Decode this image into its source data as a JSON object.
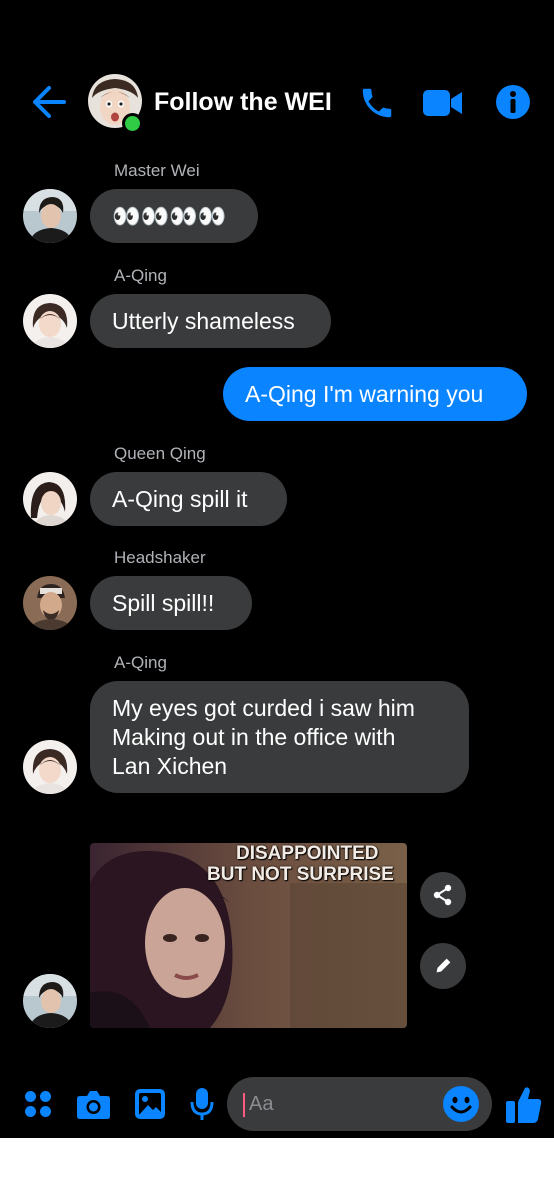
{
  "header": {
    "title": "Follow the WEI",
    "icons": [
      "back-arrow-icon",
      "phone-icon",
      "video-camera-icon",
      "info-icon"
    ],
    "online": true
  },
  "messages": [
    {
      "sender": "Master Wei",
      "text": "👀👀👀👀"
    },
    {
      "sender": "A-Qing",
      "text": "Utterly shameless"
    },
    {
      "sender": "",
      "text": "A-Qing I'm warning you",
      "outgoing": true
    },
    {
      "sender": "Queen Qing",
      "text": "A-Qing spill it"
    },
    {
      "sender": "Headshaker",
      "text": "Spill spill!!"
    },
    {
      "sender": "A-Qing",
      "lines": [
        "My eyes got curded i saw him",
        "Making out in the office with",
        "Lan Xichen"
      ]
    }
  ],
  "gif": {
    "caption_line1": "DISAPPOINTED",
    "caption_line2": "BUT NOT SURPRISE"
  },
  "composer": {
    "placeholder": "Aa",
    "icons": [
      "apps-grid-icon",
      "camera-icon",
      "gallery-icon",
      "microphone-icon",
      "emoji-icon",
      "thumbs-up-icon"
    ]
  },
  "colors": {
    "accent": "#0a84ff",
    "bubble": "#3a3b3c",
    "background": "#000000",
    "sender_text": "#b0b3b8",
    "online": "#31cc46"
  }
}
